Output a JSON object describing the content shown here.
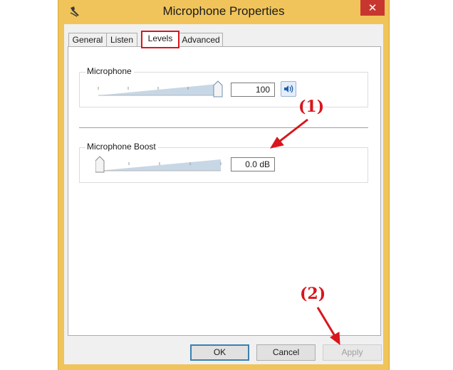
{
  "window": {
    "title": "Microphone Properties",
    "close_glyph": "✕",
    "accent_color": "#f0c45a"
  },
  "tabs": [
    {
      "label": "General"
    },
    {
      "label": "Listen"
    },
    {
      "label": "Levels",
      "active": true
    },
    {
      "label": "Advanced"
    }
  ],
  "levels": {
    "microphone": {
      "label": "Microphone",
      "value": "100",
      "level_percent": 100,
      "mute_icon": "speaker-icon"
    },
    "microphone_boost": {
      "label": "Microphone Boost",
      "value": "0.0 dB",
      "level_percent": 0
    }
  },
  "buttons": {
    "ok": "OK",
    "cancel": "Cancel",
    "apply": "Apply"
  },
  "annotations": {
    "step1": "(1)",
    "step2": "(2)",
    "color": "#d8161e"
  }
}
